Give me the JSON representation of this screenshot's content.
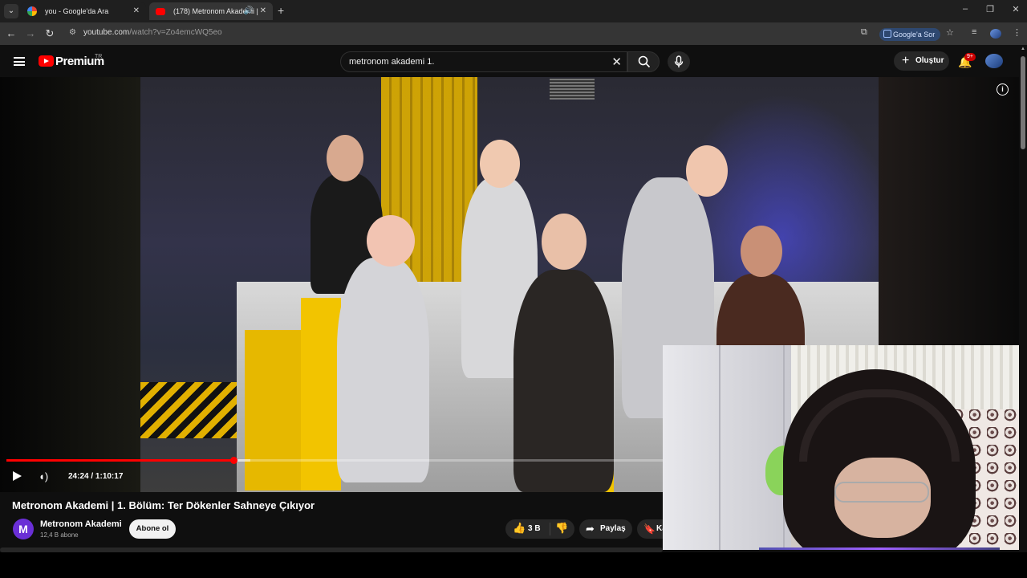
{
  "browser": {
    "tabs": [
      {
        "label": "you - Google'da Ara",
        "active": false
      },
      {
        "label": "(178) Metronom Akademi |",
        "active": true
      }
    ],
    "url_host": "youtube.com",
    "url_path": "/watch?v=Zo4emcWQ5eo",
    "google_sor_label": "Google'a Sor",
    "icons": [
      "chevron-down-icon",
      "back-icon",
      "forward-icon",
      "reload-icon",
      "site-info-icon",
      "cast-icon",
      "star-icon",
      "tab-search-icon",
      "menu-icon"
    ]
  },
  "youtube": {
    "brand": "Premium",
    "region": "TR",
    "search_value": "metronom akademi 1.",
    "create_label": "Oluştur",
    "notification_badge": "9+",
    "accent_color": "#ff0000"
  },
  "player": {
    "time_current": "24:24",
    "time_separator": "/",
    "time_total": "1:10:17",
    "played_fraction": 0.347,
    "buffered_fraction": 0.372
  },
  "video": {
    "title": "Metronom Akademi | 1. Bölüm: Ter Dökenler Sahneye Çıkıyor",
    "channel_initial": "M",
    "channel_name": "Metronom Akademi",
    "subscribers": "12,4 B abone",
    "subscribe_label": "Abone ol",
    "like_count": "3 B",
    "share_label": "Paylaş",
    "save_label": "Kaydet"
  }
}
